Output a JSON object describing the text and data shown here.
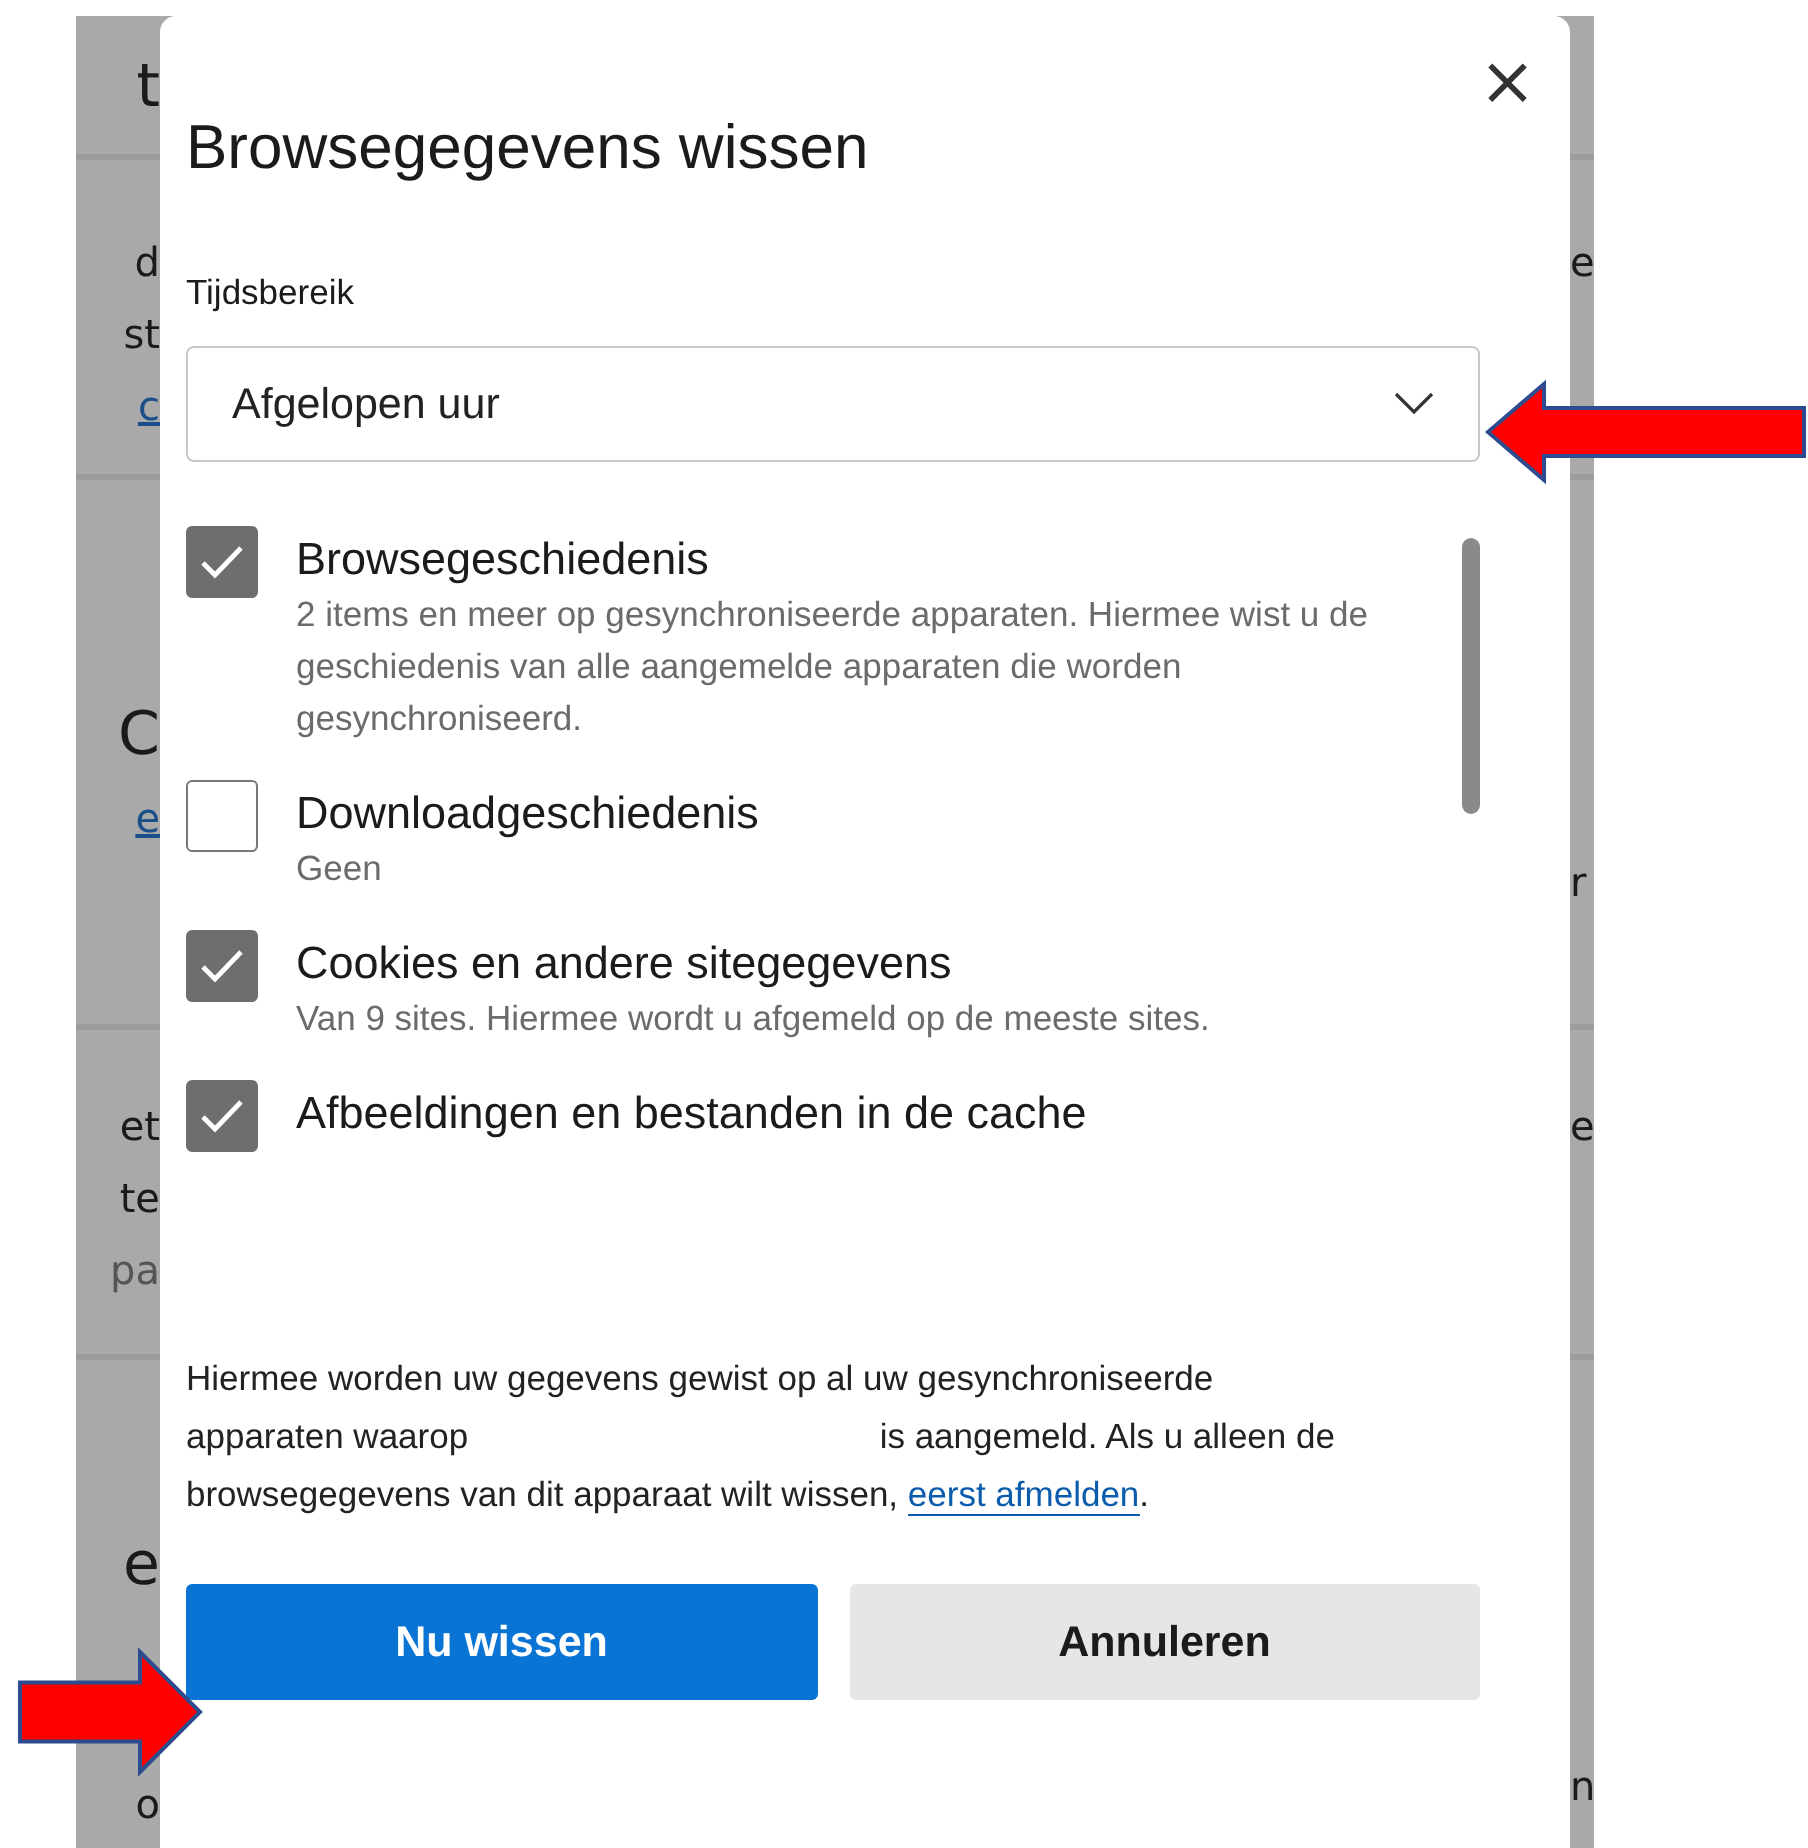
{
  "background": {
    "sections": [
      {
        "left": [
          {
            "text": "t",
            "kind": "heading"
          }
        ]
      },
      {
        "left": [
          {
            "text": "d",
            "kind": "text"
          },
          {
            "text": "st",
            "kind": "text"
          },
          {
            "text": "c",
            "kind": "link"
          }
        ],
        "right": [
          {
            "text": "e",
            "kind": "text"
          }
        ]
      },
      {
        "left": [
          {
            "text": "C",
            "kind": "heading"
          },
          {
            "text": "e",
            "kind": "link"
          }
        ],
        "right": [
          {
            "text": "r",
            "kind": "text"
          }
        ]
      },
      {
        "left": [
          {
            "text": "et",
            "kind": "text"
          },
          {
            "text": "te",
            "kind": "text"
          },
          {
            "text": "pa",
            "kind": "muted"
          }
        ],
        "right": [
          {
            "text": "e",
            "kind": "text"
          }
        ]
      },
      {
        "left": [
          {
            "text": "e",
            "kind": "heading"
          },
          {
            "text": "o",
            "kind": "text"
          }
        ],
        "right": [
          {
            "text": "n",
            "kind": "text"
          }
        ]
      }
    ]
  },
  "dialog": {
    "title": "Browsegegevens wissen",
    "close": "×",
    "time_range": {
      "label": "Tijdsbereik",
      "value": "Afgelopen uur"
    },
    "items": [
      {
        "label": "Browsegeschiedenis",
        "description": "2 items en meer op gesynchroniseerde apparaten. Hiermee wist u de geschiedenis van alle aangemelde apparaten die worden gesynchroniseerd.",
        "checked": true
      },
      {
        "label": "Downloadgeschiedenis",
        "description": "Geen",
        "checked": false
      },
      {
        "label": "Cookies en andere sitegegevens",
        "description": "Van 9 sites. Hiermee wordt u afgemeld op de meeste sites.",
        "checked": true
      },
      {
        "label": "Afbeeldingen en bestanden in de cache",
        "checked": true
      }
    ],
    "notice": {
      "before": "Hiermee worden uw gegevens gewist op al uw gesynchroniseerde apparaten waarop",
      "after": "is aangemeld. Als u alleen de browsegegevens van dit apparaat wilt wissen,",
      "link": "eerst afmelden",
      "end": "."
    },
    "buttons": [
      {
        "label": "Nu wissen",
        "kind": "primary"
      },
      {
        "label": "Annuleren",
        "kind": "secondary"
      }
    ]
  },
  "annotations": [
    {
      "kind": "pointing-left"
    },
    {
      "kind": "pointing-right"
    }
  ]
}
